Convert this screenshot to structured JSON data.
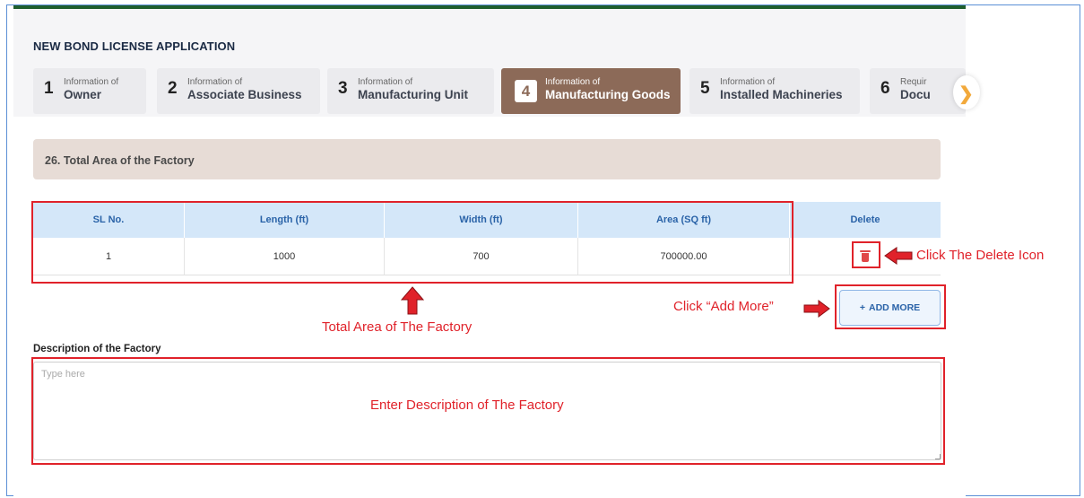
{
  "header": {
    "title": "NEW BOND LICENSE APPLICATION"
  },
  "steps": [
    {
      "num": "1",
      "small": "Information of",
      "big": "Owner",
      "active": false
    },
    {
      "num": "2",
      "small": "Information of",
      "big": "Associate Business",
      "active": false
    },
    {
      "num": "3",
      "small": "Information of",
      "big": "Manufacturing Unit",
      "active": false
    },
    {
      "num": "4",
      "small": "Information of",
      "big": "Manufacturing Goods",
      "active": true
    },
    {
      "num": "5",
      "small": "Information of",
      "big": "Installed Machineries",
      "active": false
    },
    {
      "num": "6",
      "small": "Requir",
      "big": "Docu",
      "active": false
    }
  ],
  "section": {
    "label": "26. Total Area of the Factory"
  },
  "table": {
    "headers": [
      "SL No.",
      "Length (ft)",
      "Width (ft)",
      "Area (SQ ft)",
      "Delete"
    ],
    "rows": [
      [
        "1",
        "1000",
        "700",
        "700000.00"
      ]
    ]
  },
  "add_more": {
    "icon": "+",
    "label": "ADD MORE"
  },
  "description": {
    "label": "Description of the Factory",
    "placeholder": "Type here",
    "value": ""
  },
  "annotations": {
    "delete_icon": "Click The Delete Icon",
    "add_more": "Click “Add More”",
    "total_area": "Total Area of The Factory",
    "description": "Enter Description of The Factory"
  },
  "colors": {
    "annotation_red": "#e0222a",
    "active_step": "#8c6a58",
    "header_green": "#1f5e2e",
    "table_header": "#d4e7f9"
  },
  "icons": {
    "delete": "trash-icon",
    "next_step": "chevron-right-icon"
  }
}
